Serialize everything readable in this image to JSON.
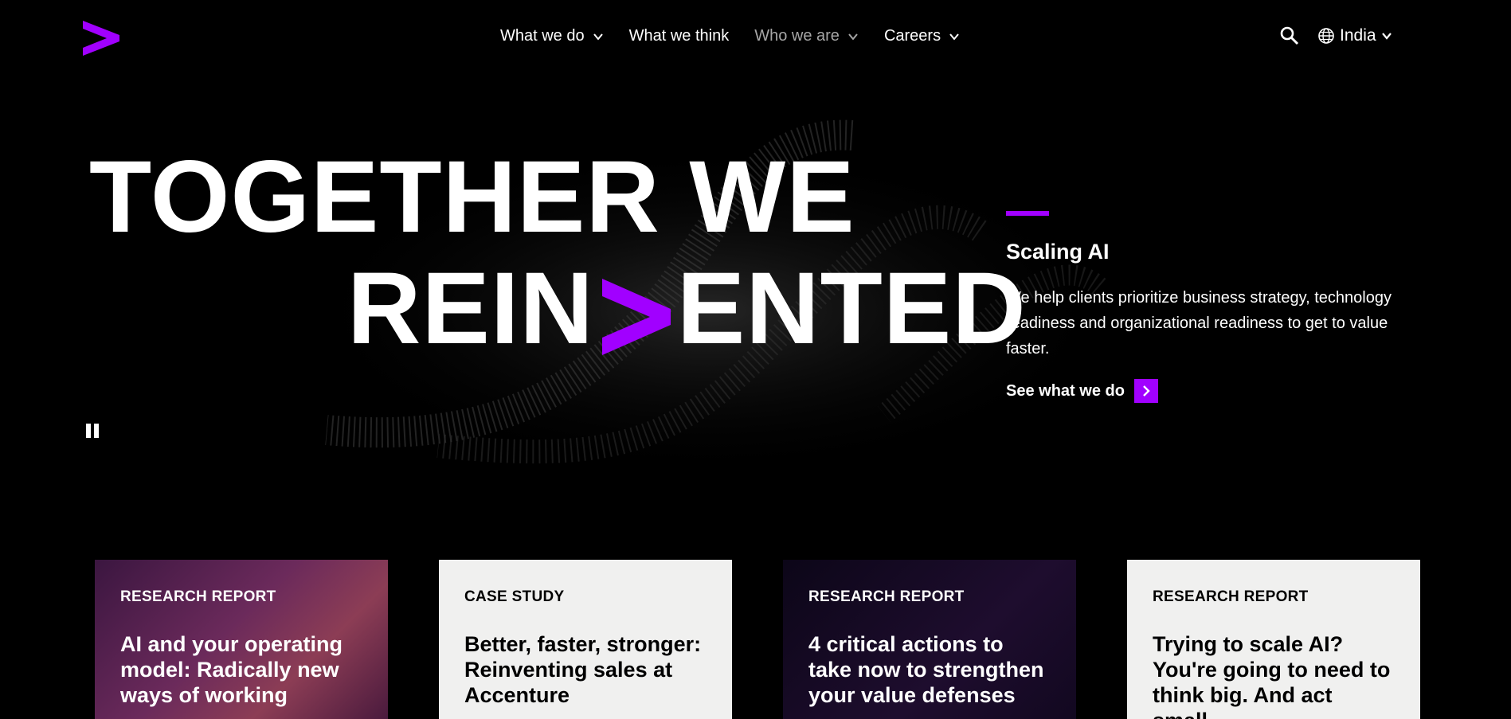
{
  "header": {
    "nav": [
      {
        "label": "What we do",
        "has_dropdown": true,
        "active": true
      },
      {
        "label": "What we think",
        "has_dropdown": false,
        "active": true
      },
      {
        "label": "Who we are",
        "has_dropdown": true,
        "active": false
      },
      {
        "label": "Careers",
        "has_dropdown": true,
        "active": true
      }
    ],
    "locale": "India",
    "icons": [
      "accenture-logo",
      "search-icon",
      "globe-icon",
      "chevron-down-icon"
    ]
  },
  "hero": {
    "line1": "TOGETHER WE",
    "line2_prefix": "REIN",
    "line2_suffix": "ENTED",
    "feature": {
      "title": "Scaling AI",
      "description": "We help clients prioritize business strategy, technology readiness and organizational readiness to get to value faster.",
      "cta": "See what we do"
    }
  },
  "cards": [
    {
      "tag": "RESEARCH REPORT",
      "title": "AI and your operating model: Radically new ways of working"
    },
    {
      "tag": "CASE STUDY",
      "title": "Better, faster, stronger: Reinventing sales at Accenture"
    },
    {
      "tag": "RESEARCH REPORT",
      "title": "4 critical actions to take now to strengthen your value defenses"
    },
    {
      "tag": "RESEARCH REPORT",
      "title": "Trying to scale AI? You're going to need to think big. And act small."
    }
  ],
  "colors": {
    "accent": "#a100ff",
    "background": "#000000",
    "card_light": "#f0f0ef"
  }
}
